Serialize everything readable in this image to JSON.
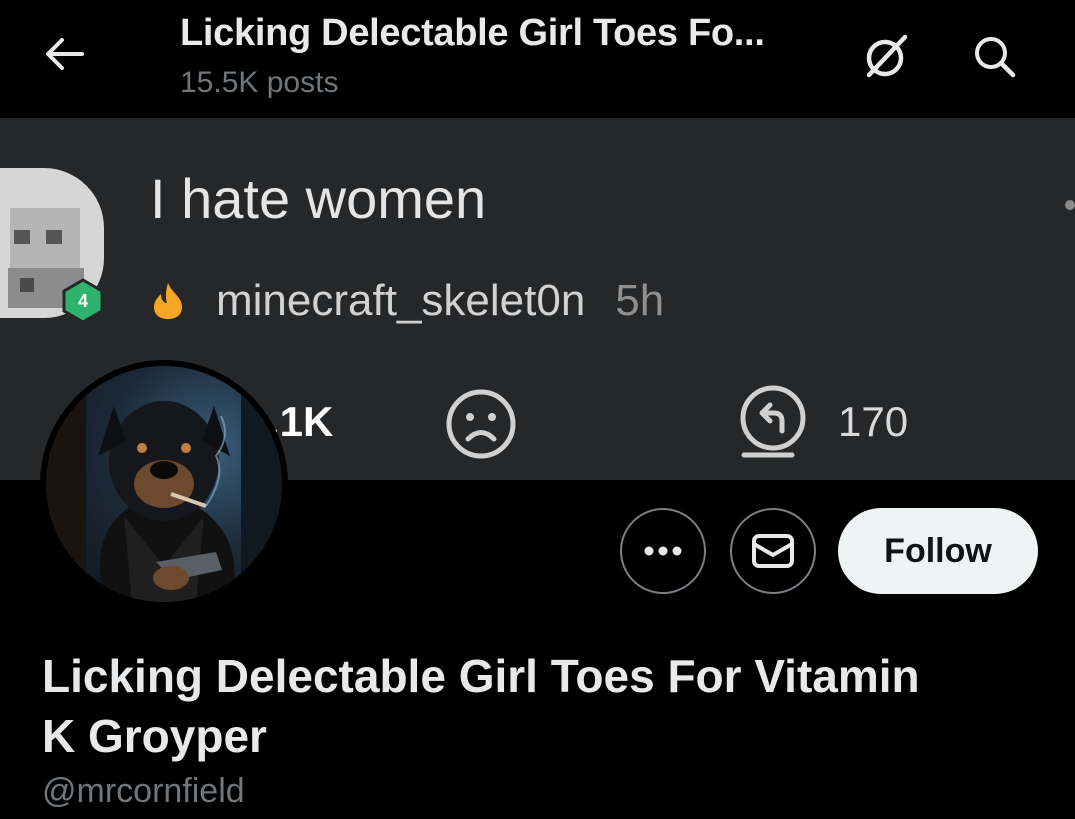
{
  "header": {
    "title": "Licking Delectable Girl Toes Fo...",
    "subtitle": "15.5K posts",
    "back_icon": "arrow-left-icon",
    "grok_icon": "grok-icon",
    "search_icon": "search-icon"
  },
  "banner": {
    "comment_text": "I hate women",
    "level_badge": "4",
    "username": "minecraft_skelet0n",
    "time": "5h",
    "likes": ".1K",
    "reply_count": "170",
    "accent_color": "#f5a623",
    "badge_color": "#2db36b"
  },
  "profile": {
    "display_name": "Licking Delectable Girl Toes For Vitamin K Groyper",
    "handle": "@mrcornfield"
  },
  "actions": {
    "more_icon": "more-icon",
    "message_icon": "mail-icon",
    "follow_label": "Follow"
  }
}
